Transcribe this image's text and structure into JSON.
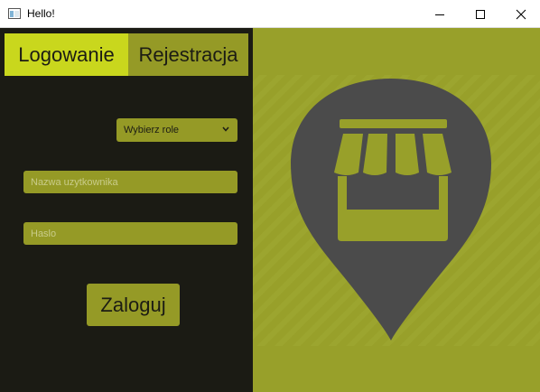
{
  "window": {
    "title": "Hello!",
    "icons": {
      "app": "app-window-icon",
      "minimize": "minimize-icon",
      "maximize": "maximize-icon",
      "close": "close-icon"
    }
  },
  "tabs": [
    {
      "label": "Logowanie",
      "active": true
    },
    {
      "label": "Rejestracja",
      "active": false
    }
  ],
  "form": {
    "role_select": {
      "value": "Wybierz role",
      "icon": "chevron-down-icon"
    },
    "username": {
      "placeholder": "Nazwa uzytkownika",
      "value": ""
    },
    "password": {
      "placeholder": "Haslo",
      "value": ""
    },
    "submit_label": "Zaloguj"
  },
  "illustration": {
    "icon": "shop-location-pin-icon"
  },
  "colors": {
    "left_bg": "#1b1b14",
    "right_bg": "#98a02a",
    "active_tab": "#c9d71d",
    "control_bg": "#959a26",
    "pin": "#4b4b4b"
  }
}
